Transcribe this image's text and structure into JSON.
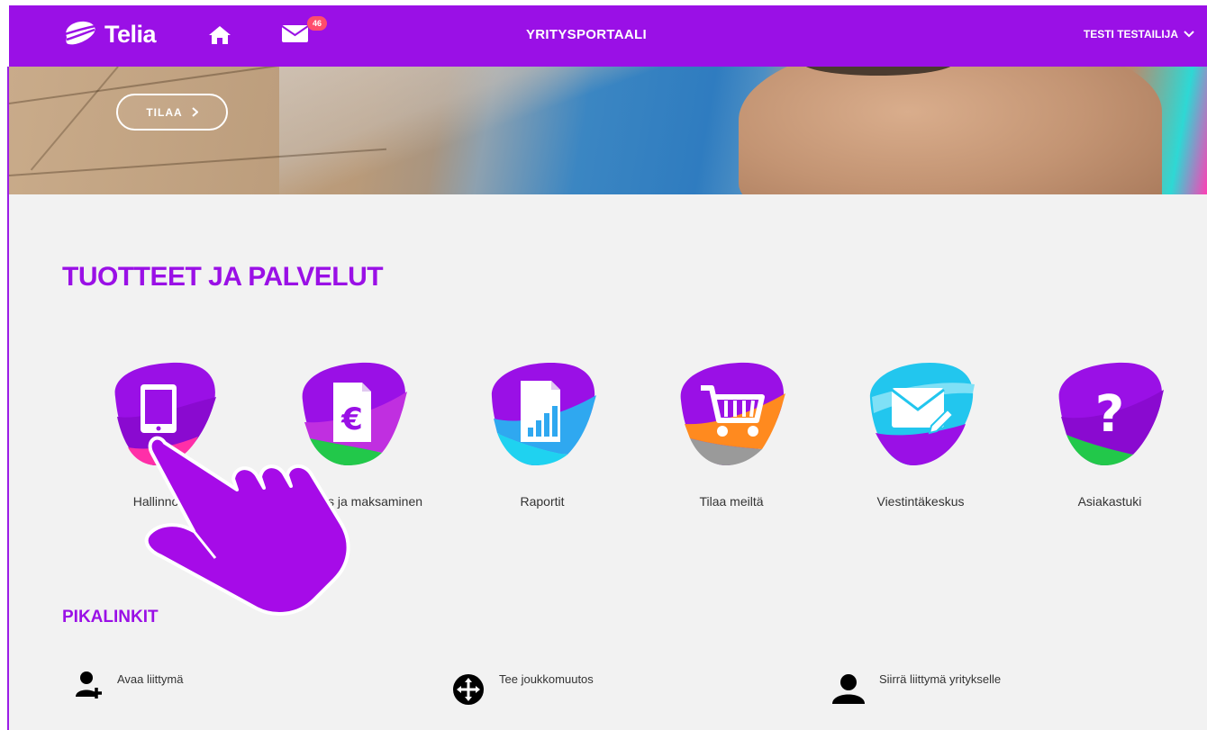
{
  "header": {
    "logo_text": "Telia",
    "mail_count": "46",
    "portal_title": "YRITYSPORTAALI",
    "user_name": "TESTI TESTAILIJA"
  },
  "hero": {
    "order_button": "TILAA"
  },
  "products": {
    "title": "TUOTTEET JA PALVELUT",
    "items": [
      {
        "label": "Hallinnointi",
        "icon": "tablet-icon"
      },
      {
        "label": "Laskutus ja maksaminen",
        "icon": "invoice-euro-icon"
      },
      {
        "label": "Raportit",
        "icon": "report-chart-icon"
      },
      {
        "label": "Tilaa meiltä",
        "icon": "shopping-cart-icon"
      },
      {
        "label": "Viestintäkeskus",
        "icon": "envelope-icon"
      },
      {
        "label": "Asiakastuki",
        "icon": "question-mark-icon"
      }
    ]
  },
  "quick_links": {
    "title": "PIKALINKIT",
    "items": [
      {
        "label": "Avaa liittymä",
        "icon": "add-user-icon"
      },
      {
        "label": "Tee joukkomuutos",
        "icon": "move-arrows-icon"
      },
      {
        "label": "Siirrä liittymä yritykselle",
        "icon": "user-icon"
      }
    ]
  },
  "colors": {
    "brand_purple": "#9a10e6",
    "background": "#f2f2f2"
  }
}
